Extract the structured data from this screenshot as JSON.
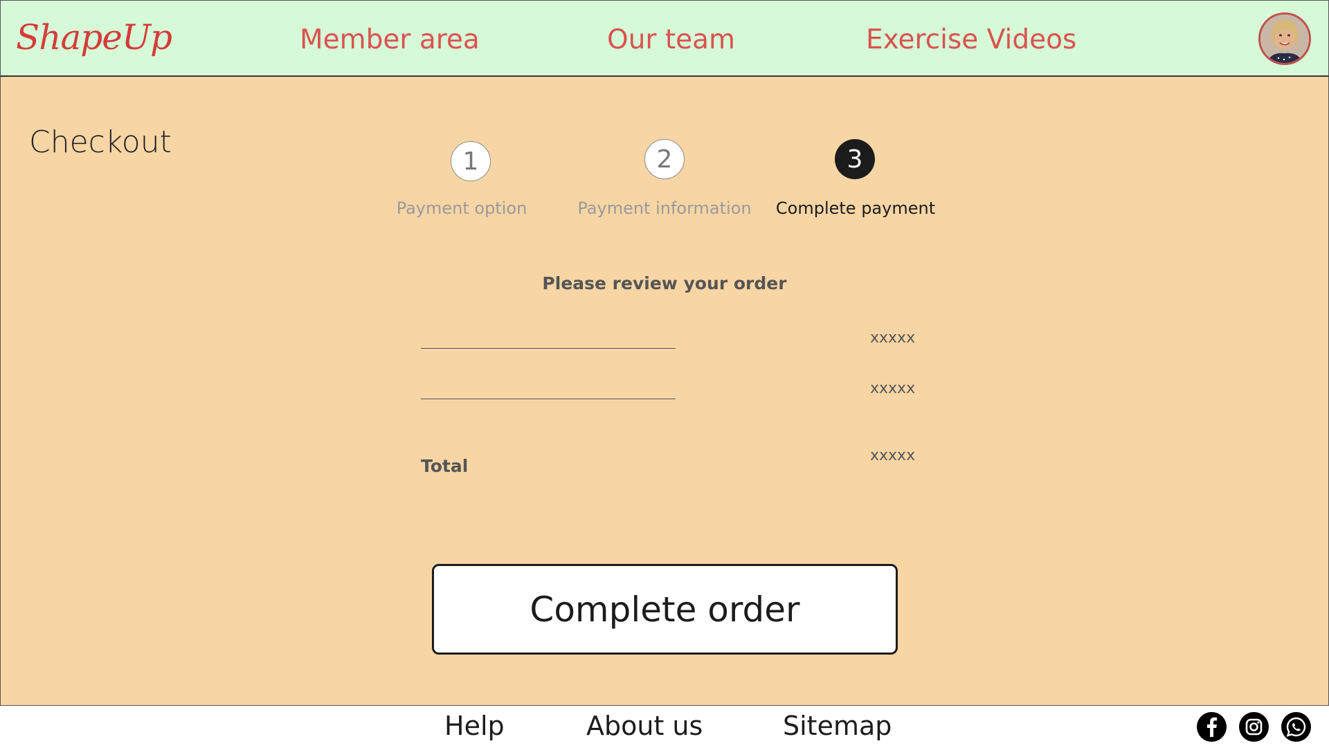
{
  "header": {
    "logo": "ShapeUp",
    "nav": [
      {
        "label": "Member area"
      },
      {
        "label": "Our team"
      },
      {
        "label": "Exercise Videos"
      }
    ]
  },
  "checkout": {
    "title": "Checkout",
    "steps": [
      {
        "number": "1",
        "label": "Payment option",
        "state": "inactive"
      },
      {
        "number": "2",
        "label": "Payment information",
        "state": "inactive"
      },
      {
        "number": "3",
        "label": "Complete payment",
        "state": "active"
      }
    ],
    "review_heading": "Please review your order",
    "items": [
      {
        "name": "",
        "amount": "xxxxx"
      },
      {
        "name": "",
        "amount": "xxxxx"
      }
    ],
    "total_label": "Total",
    "total_amount": "xxxxx",
    "complete_button": "Complete order"
  },
  "footer": {
    "links": [
      {
        "label": "Help"
      },
      {
        "label": "About us"
      },
      {
        "label": "Sitemap"
      }
    ],
    "social_icons": [
      "facebook-icon",
      "instagram-icon",
      "whatsapp-icon"
    ]
  },
  "colors": {
    "header_bg": "#d6fad8",
    "main_bg": "#f8d5a5",
    "accent_red": "#d9534f",
    "dark": "#1c1c1c"
  }
}
